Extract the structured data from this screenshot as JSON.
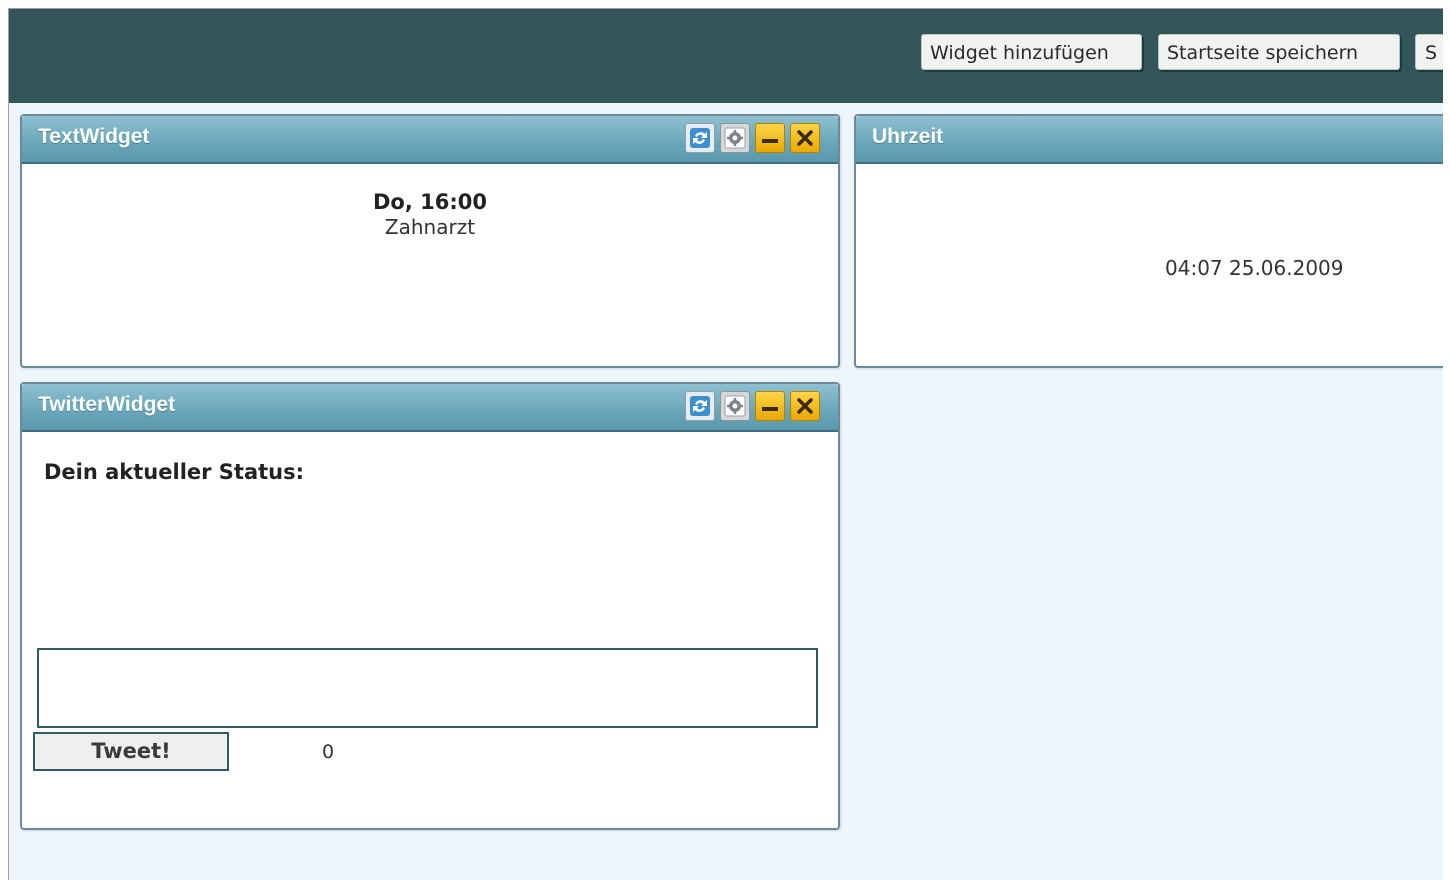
{
  "toolbar": {
    "buttons": [
      {
        "label": "Widget hinzufügen"
      },
      {
        "label": "Startseite speichern"
      },
      {
        "label": "S"
      }
    ]
  },
  "widgets": {
    "text": {
      "title": "TextWidget",
      "line1": "Do, 16:00",
      "line2": "Zahnarzt"
    },
    "clock": {
      "title": "Uhrzeit",
      "value": "04:07 25.06.2009"
    },
    "twitter": {
      "title": "TwitterWidget",
      "status_label": "Dein aktueller Status:",
      "status_input": "",
      "tweet_label": "Tweet!",
      "counter": "0"
    }
  },
  "icons": [
    "refresh-icon",
    "gear-icon",
    "minimize-icon",
    "close-icon"
  ],
  "colors": {
    "topbar": "#325557",
    "widget_header": "#6ba8bb",
    "page_bg": "#eef5fc",
    "control_yellow": "#f0b400"
  }
}
